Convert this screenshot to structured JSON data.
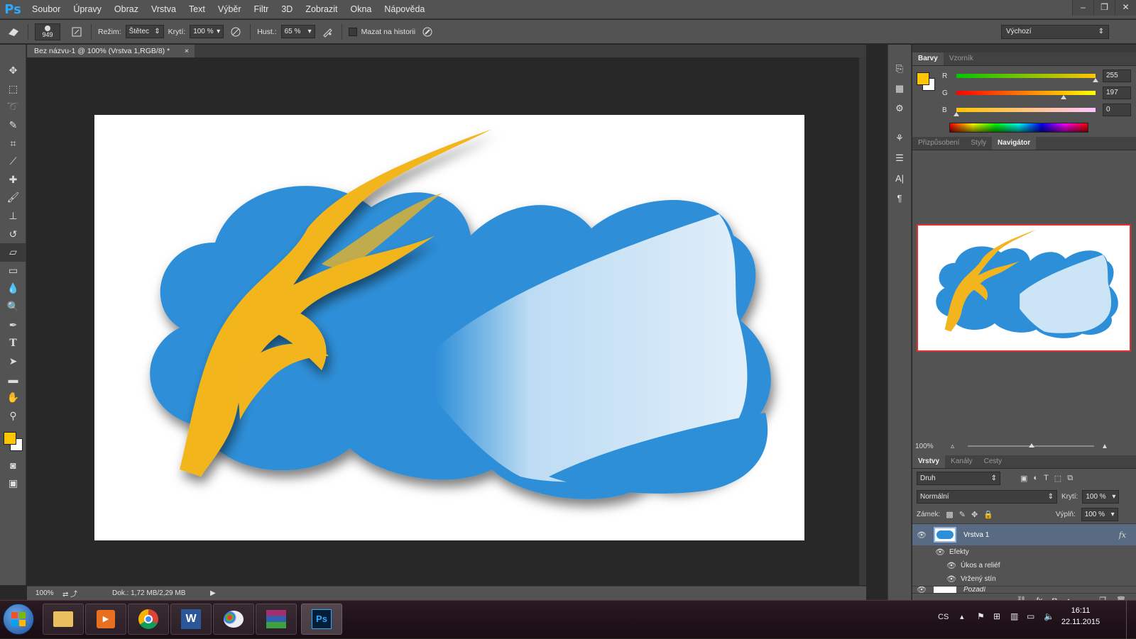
{
  "app": {
    "logo": "Ps"
  },
  "menu": [
    "Soubor",
    "Úpravy",
    "Obraz",
    "Vrstva",
    "Text",
    "Výběr",
    "Filtr",
    "3D",
    "Zobrazit",
    "Okna",
    "Nápověda"
  ],
  "window_controls": [
    "–",
    "❐",
    "✕"
  ],
  "options": {
    "brush_size": "949",
    "mode_label": "Režim:",
    "mode_value": "Štětec",
    "opacity_label": "Krytí:",
    "opacity_value": "100 %",
    "flow_label": "Hust.:",
    "flow_value": "65 %",
    "erase_history_label": "Mazat na historii",
    "workspace": "Výchozí"
  },
  "document": {
    "tab_title": "Bez názvu-1 @ 100% (Vrstva 1,RGB/8) *",
    "tab_close": "×",
    "zoom": "100%",
    "doc_size": "Dok.: 1,72 MB/2,29 MB"
  },
  "colors": {
    "foreground": "#ffc500",
    "background": "#ffffff",
    "canvas_blue": "#2d8fd8",
    "canvas_yellow": "#f2b51e"
  },
  "color_panel": {
    "tabs": [
      "Barvy",
      "Vzorník"
    ],
    "active_tab": "Barvy",
    "channels": [
      {
        "label": "R",
        "value": "255",
        "level": 1.0
      },
      {
        "label": "G",
        "value": "197",
        "level": 0.77
      },
      {
        "label": "B",
        "value": "0",
        "level": 0.0
      }
    ]
  },
  "navigator_panel": {
    "tabs": [
      "Přizpůsobení",
      "Styly",
      "Navigátor"
    ],
    "active_tab": "Navigátor",
    "zoom": "100%"
  },
  "layers_panel": {
    "tabs": [
      "Vrstvy",
      "Kanály",
      "Cesty"
    ],
    "active_tab": "Vrstvy",
    "filter_label": "Druh",
    "blend_mode": "Normální",
    "opacity_label": "Krytí:",
    "opacity_value": "100 %",
    "lock_label": "Zámek:",
    "fill_label": "Výplň:",
    "fill_value": "100 %",
    "layer_name": "Vrstva 1",
    "fx": "fx",
    "effects_label": "Efekty",
    "effects": [
      "Úkos a reliéf",
      "Vržený stín"
    ],
    "background_layer": "Pozadí"
  },
  "taskbar": {
    "language": "CS",
    "time": "16:11",
    "date": "22.11.2015"
  }
}
